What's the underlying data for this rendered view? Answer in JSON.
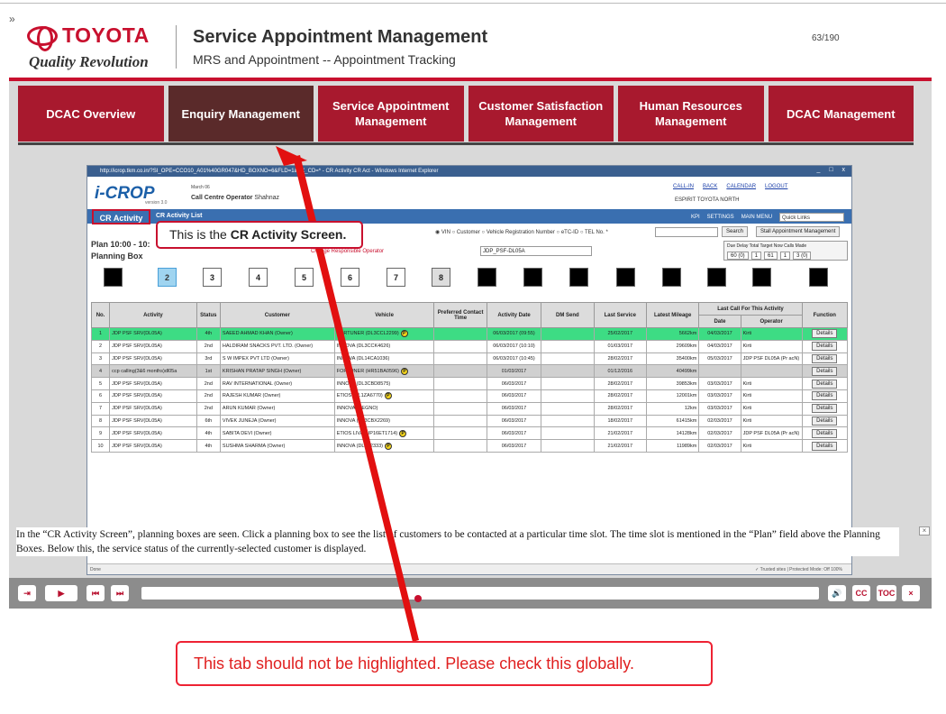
{
  "header": {
    "expand_icon": "»",
    "logo_text": "TOYOTA",
    "tagline": "Quality Revolution",
    "title": "Service Appointment Management",
    "subtitle": "MRS and Appointment --  Appointment Tracking",
    "page_number": "63/190"
  },
  "nav": [
    {
      "label": "DCAC Overview",
      "active": false
    },
    {
      "label": "Enquiry Management",
      "active": true
    },
    {
      "label": "Service Appointment Management",
      "active": false
    },
    {
      "label": "Customer Satisfaction Management",
      "active": false
    },
    {
      "label": "Human Resources Management",
      "active": false
    },
    {
      "label": "DCAC Management",
      "active": false
    }
  ],
  "window": {
    "title": "http://icrop.tkm.co.in/?SI_OPE=CCO10_A01%40GR047&HD_BOXNO=6&FLD=1&TX_CD=* - CR Activity CR Act - Windows Internet Explorer",
    "controls": "_ □ x",
    "app_name": "i-CROP",
    "app_version": "version 3.0",
    "date": "March 06",
    "operator_label": "Call Centre Operator",
    "operator_name": "Shahnaz",
    "links": [
      "CALL-IN",
      "BACK",
      "CALENDAR",
      "LOGOUT"
    ],
    "dealer": "ESPIRIT TOYOTA NORTH",
    "tab_active": "CR Activity",
    "tab_second": "CR Activity List",
    "tab_right": [
      "KPI",
      "SETTINGS",
      "MAIN MENU"
    ],
    "quick_links": "Quick Links",
    "search_radios": "◉ VIN  ○ Customer  ○ Vehicle Registration Number  ○ eTC-ID  ○ TEL No. *",
    "search_button": "Search",
    "stall_button": "Stall Appointment Management",
    "plan": "Plan 10:00 - 10:",
    "planning_box_label": "Planning Box",
    "operator_link": "Change Responsible Operator",
    "psf_select": "JDP_PSF-DL05A",
    "stats_header": "Due   Delay  Total  Target  Now  Calls Made",
    "stats_values": [
      "60 (0)",
      "1",
      "61",
      "1",
      "3 (0)"
    ],
    "planning_boxes": [
      {
        "label": "",
        "style": "black"
      },
      {
        "label": "2",
        "style": "sel"
      },
      {
        "label": "3",
        "style": "white"
      },
      {
        "label": "4",
        "style": "white"
      },
      {
        "label": "5",
        "style": "white"
      },
      {
        "label": "6",
        "style": "white"
      },
      {
        "label": "7",
        "style": "white"
      },
      {
        "label": "8",
        "style": "gray"
      },
      {
        "label": "",
        "style": "black"
      },
      {
        "label": "",
        "style": "black"
      },
      {
        "label": "",
        "style": "black"
      },
      {
        "label": "",
        "style": "black"
      },
      {
        "label": "",
        "style": "black"
      },
      {
        "label": "",
        "style": "black"
      },
      {
        "label": "",
        "style": "black"
      },
      {
        "label": "",
        "style": "black"
      }
    ],
    "table_headers": [
      "No.",
      "Activity",
      "Status",
      "Customer",
      "Vehicle",
      "Preferred Contact Time",
      "Activity Date",
      "DM Send",
      "Last Service",
      "Latest Mileage",
      "Last Call For This Activity",
      "Function"
    ],
    "table_subheaders": [
      "Date",
      "Operator"
    ],
    "rows": [
      {
        "no": "1",
        "activity": "JDP PSF SRV(DL05A)",
        "status": "4th",
        "customer": "SAEED AHMAD KHAN (Owner)",
        "vehicle": "FORTUNER (DL3CCL2299)",
        "badge": true,
        "pref": "",
        "adate": "06/03/2017 (09:55)",
        "dm": "",
        "last": "25/02/2017",
        "mileage": "5662km",
        "cdate": "04/03/2017",
        "op": "Kirti",
        "fn": "Details",
        "style": "hl"
      },
      {
        "no": "2",
        "activity": "JDP PSF SRV(DL05A)",
        "status": "2nd",
        "customer": "HALDIRAM SNACKS PVT. LTD. (Owner)",
        "vehicle": "INNOVA (DL3CCK4626)",
        "badge": false,
        "pref": "",
        "adate": "06/03/2017 (10:10)",
        "dm": "",
        "last": "01/03/2017",
        "mileage": "29609km",
        "cdate": "04/03/2017",
        "op": "Kirti",
        "fn": "Details",
        "style": ""
      },
      {
        "no": "3",
        "activity": "JDP PSF SRV(DL05A)",
        "status": "3rd",
        "customer": "S W IMPEX PVT LTD (Owner)",
        "vehicle": "INNOVA (DL14CA1036)",
        "badge": false,
        "pref": "",
        "adate": "06/03/2017 (10:45)",
        "dm": "",
        "last": "28/02/2017",
        "mileage": "35400km",
        "cdate": "05/03/2017",
        "op": "JDP PSF DL05A (Pr acN)",
        "fn": "Details",
        "style": ""
      },
      {
        "no": "4",
        "activity": "ccp calling(3&6 months)dl05a",
        "status": "1st",
        "customer": "KRISHAN PRATAP SINGH (Owner)",
        "vehicle": "FORTUNER (HR51BA0596)",
        "badge": true,
        "pref": "",
        "adate": "01/03/2017",
        "dm": "",
        "last": "01/12/2016",
        "mileage": "40499km",
        "cdate": "",
        "op": "",
        "fn": "Details",
        "style": "gray"
      },
      {
        "no": "5",
        "activity": "JDP PSF SRV(DL05A)",
        "status": "2nd",
        "customer": "RAV INTERNATIONAL (Owner)",
        "vehicle": "INNOVA (DL3CBD8575)",
        "badge": false,
        "pref": "",
        "adate": "06/03/2017",
        "dm": "",
        "last": "28/02/2017",
        "mileage": "39853km",
        "cdate": "03/03/2017",
        "op": "Kirti",
        "fn": "Details",
        "style": ""
      },
      {
        "no": "6",
        "activity": "JDP PSF SRV(DL05A)",
        "status": "2nd",
        "customer": "RAJESH KUMAR (Owner)",
        "vehicle": "ETIOS (DL1ZA6770)",
        "badge": true,
        "pref": "",
        "adate": "06/03/2017",
        "dm": "",
        "last": "28/02/2017",
        "mileage": "12001km",
        "cdate": "03/03/2017",
        "op": "Kirti",
        "fn": "Details",
        "style": ""
      },
      {
        "no": "7",
        "activity": "JDP PSF SRV(DL05A)",
        "status": "2nd",
        "customer": "ARUN KUMAR (Owner)",
        "vehicle": "INNOVA (REGNO)",
        "badge": false,
        "pref": "",
        "adate": "06/03/2017",
        "dm": "",
        "last": "28/02/2017",
        "mileage": "12km",
        "cdate": "03/03/2017",
        "op": "Kirti",
        "fn": "Details",
        "style": ""
      },
      {
        "no": "8",
        "activity": "JDP PSF SRV(DL05A)",
        "status": "6th",
        "customer": "VIVEK JUNEJA (Owner)",
        "vehicle": "INNOVA (DL3CBX2269)",
        "badge": false,
        "pref": "",
        "adate": "06/03/2017",
        "dm": "",
        "last": "18/02/2017",
        "mileage": "61415km",
        "cdate": "02/03/2017",
        "op": "Kirti",
        "fn": "Details",
        "style": ""
      },
      {
        "no": "9",
        "activity": "JDP PSF SRV(DL05A)",
        "status": "4th",
        "customer": "SABITA DEVI (Owner)",
        "vehicle": "ETIOS LIVA (UP16ET1714)",
        "badge": true,
        "pref": "",
        "adate": "06/03/2017",
        "dm": "",
        "last": "21/02/2017",
        "mileage": "14128km",
        "cdate": "02/03/2017",
        "op": "JDP PSF DL05A (Pr acN)",
        "fn": "Details",
        "style": ""
      },
      {
        "no": "10",
        "activity": "JDP PSF SRV(DL05A)",
        "status": "4th",
        "customer": "SUSHMA SHARMA (Owner)",
        "vehicle": "INNOVA (DL8F2333)",
        "badge": true,
        "pref": "",
        "adate": "06/03/2017",
        "dm": "",
        "last": "21/02/2017",
        "mileage": "11989km",
        "cdate": "02/03/2017",
        "op": "Kirti",
        "fn": "Details",
        "style": ""
      }
    ],
    "status_left": "Done",
    "status_right": "✓ Trusted sites | Protected Mode: Off          100%"
  },
  "callout": {
    "prefix": "This is the ",
    "bold": "CR Activity Screen."
  },
  "caption": "In the “CR Activity Screen”, planning boxes are seen. Click a planning box to see the list of customers to be contacted at a particular time slot. The time slot is mentioned in the “Plan” field above the Planning Boxes. Below this, the service status of the currently-selected customer is displayed.",
  "caption_close": "×",
  "player": {
    "exit": "⇥",
    "play": "▶",
    "prev": "⏮",
    "next": "⏭",
    "volume": "🔊",
    "cc": "CC",
    "toc": "TOC",
    "close": "×"
  },
  "annotation": "This tab should not be highlighted. Please check this globally.",
  "colors": {
    "brand_red": "#c8102e",
    "active_tab": "#5a2a2a",
    "highlight_row": "#3ddc84"
  }
}
